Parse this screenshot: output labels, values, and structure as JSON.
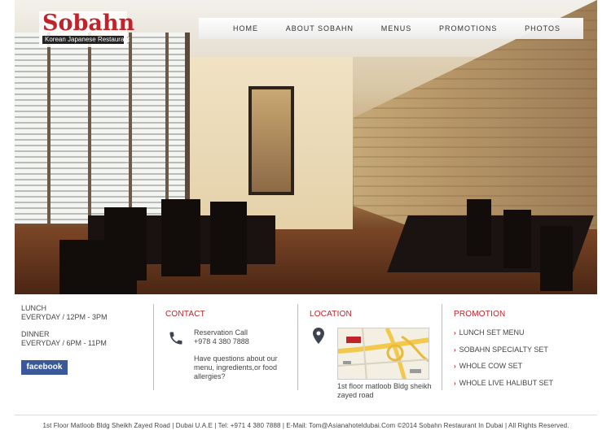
{
  "brand": {
    "name": "Sobahn",
    "tagline": "Korean Japanese Restaurant",
    "accent_color": "#c0242b"
  },
  "nav": {
    "items": [
      {
        "label": "HOME"
      },
      {
        "label": "ABOUT SOBAHN"
      },
      {
        "label": "MENUS"
      },
      {
        "label": "PROMOTIONS"
      },
      {
        "label": "PHOTOS"
      }
    ]
  },
  "hero": {
    "icon": "restaurant-interior-photo"
  },
  "hours": {
    "lunch_title": "LUNCH",
    "lunch_time": "EVERYDAY / 12PM - 3PM",
    "dinner_title": "DINNER",
    "dinner_time": "EVERYDAY / 6PM - 11PM",
    "facebook_label": "facebook"
  },
  "contact": {
    "title": "CONTACT",
    "icon": "phone-icon",
    "reservation_label": "Reservation Call",
    "phone": "+978 4 380 7888",
    "question": "Have questions about our menu, ingredients,or food allergies?"
  },
  "location": {
    "title": "LOCATION",
    "icon": "map-pin-icon",
    "address": "1st floor matloob Bldg sheikh zayed road"
  },
  "promotion": {
    "title": "PROMOTION",
    "bullet_icon": "red-chevron-bullet",
    "items": [
      {
        "label": "LUNCH SET MENU"
      },
      {
        "label": "SOBAHN SPECIALTY SET"
      },
      {
        "label": "WHOLE COW SET"
      },
      {
        "label": "WHOLE LIVE HALIBUT SET"
      }
    ]
  },
  "footer": {
    "text": "1st Floor Matloob Bldg Sheikh Zayed Road | Dubai U.A.E | Tel: +971 4 380 7888 | E-Mail: Tom@Asianahoteldubai.Com ©2014 Sobahn Restaurant In Dubai | All Rights Reserved."
  }
}
